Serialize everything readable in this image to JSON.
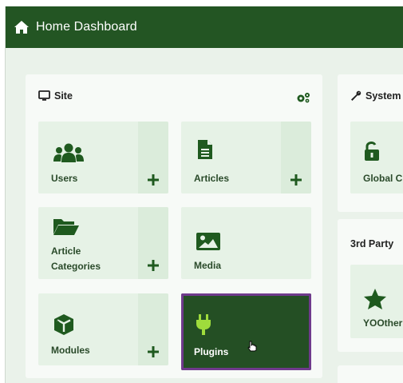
{
  "header": {
    "title": "Home Dashboard",
    "icon": "home-icon"
  },
  "site_panel": {
    "title": "Site",
    "icon": "monitor-icon",
    "settings_icon": "gears-icon",
    "tiles": [
      {
        "label": "Users",
        "icon": "users-icon",
        "has_add": true
      },
      {
        "label": "Articles",
        "icon": "file-icon",
        "has_add": true
      },
      {
        "label_line1": "Article",
        "label_line2": "Categories",
        "icon": "folder-open-icon",
        "has_add": true
      },
      {
        "label": "Media",
        "icon": "image-icon",
        "has_add": false
      },
      {
        "label": "Modules",
        "icon": "cube-icon",
        "has_add": true
      },
      {
        "label": "Plugins",
        "icon": "plug-icon",
        "has_add": false,
        "state": "hovered"
      }
    ]
  },
  "system_panel": {
    "title": "System",
    "icon": "wrench-icon",
    "tile_label": "Global C",
    "tile_icon": "unlock-icon"
  },
  "third_party_panel": {
    "title": "3rd Party",
    "tile_label": "YOOther",
    "tile_icon": "star-icon"
  },
  "colors": {
    "header_bg": "#235523",
    "page_bg": "#eaf2ea",
    "tile_bg": "#e6f2e6",
    "icon_green": "#1f5a1f",
    "active_tile_bg": "#244f24",
    "active_outline": "#6f3a8c"
  }
}
